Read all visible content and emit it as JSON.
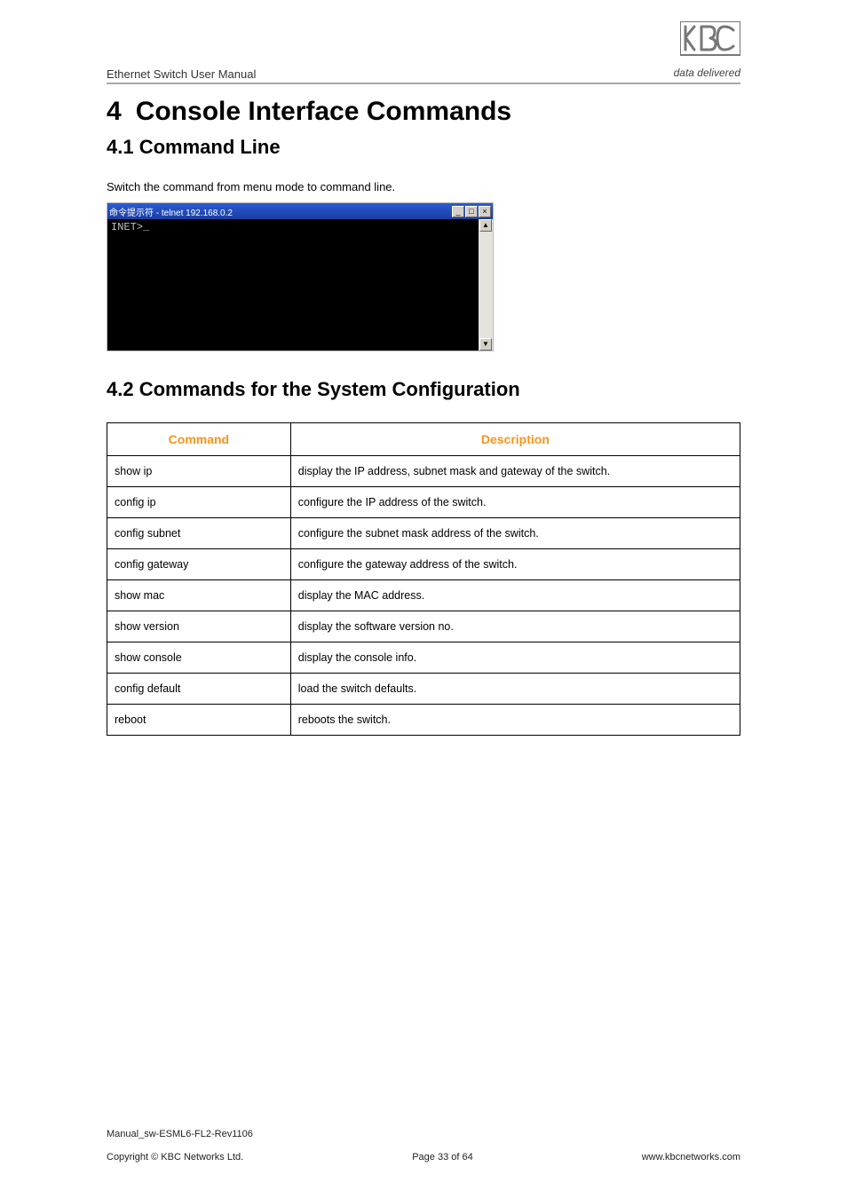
{
  "header": {
    "doc_title": "Ethernet Switch User Manual",
    "logo_tagline": "data delivered"
  },
  "headings": {
    "h1_num": "4",
    "h1_text": "Console Interface Commands",
    "h2a": "4.1 Command Line",
    "h2b": "4.2 Commands for the System Configuration"
  },
  "body": {
    "switch_cmd_text": "Switch the command from menu mode to command line."
  },
  "terminal": {
    "title": "命令提示符 - telnet 192.168.0.2",
    "prompt": "INET>_",
    "min": "_",
    "max": "□",
    "close": "×",
    "up": "▲",
    "down": "▼"
  },
  "table": {
    "head_cmd": "Command",
    "head_desc": "Description",
    "rows": [
      {
        "cmd": "show ip",
        "desc": "display the IP address, subnet mask and gateway of the switch."
      },
      {
        "cmd": "config ip",
        "desc": "configure the IP address of the switch."
      },
      {
        "cmd": "config subnet",
        "desc": "configure the subnet mask address of the switch."
      },
      {
        "cmd": "config gateway",
        "desc": "configure the gateway address of the switch."
      },
      {
        "cmd": "show mac",
        "desc": "display the MAC address."
      },
      {
        "cmd": "show version",
        "desc": "display the software version no."
      },
      {
        "cmd": "show console",
        "desc": "display the console info."
      },
      {
        "cmd": "config default",
        "desc": "load the switch defaults."
      },
      {
        "cmd": "reboot",
        "desc": "reboots the switch."
      }
    ]
  },
  "footer": {
    "manual_id": "Manual_sw-ESML6-FL2-Rev1106",
    "copyright": "Copyright © KBC Networks Ltd.",
    "page": "Page 33 of 64",
    "url": "www.kbcnetworks.com"
  }
}
